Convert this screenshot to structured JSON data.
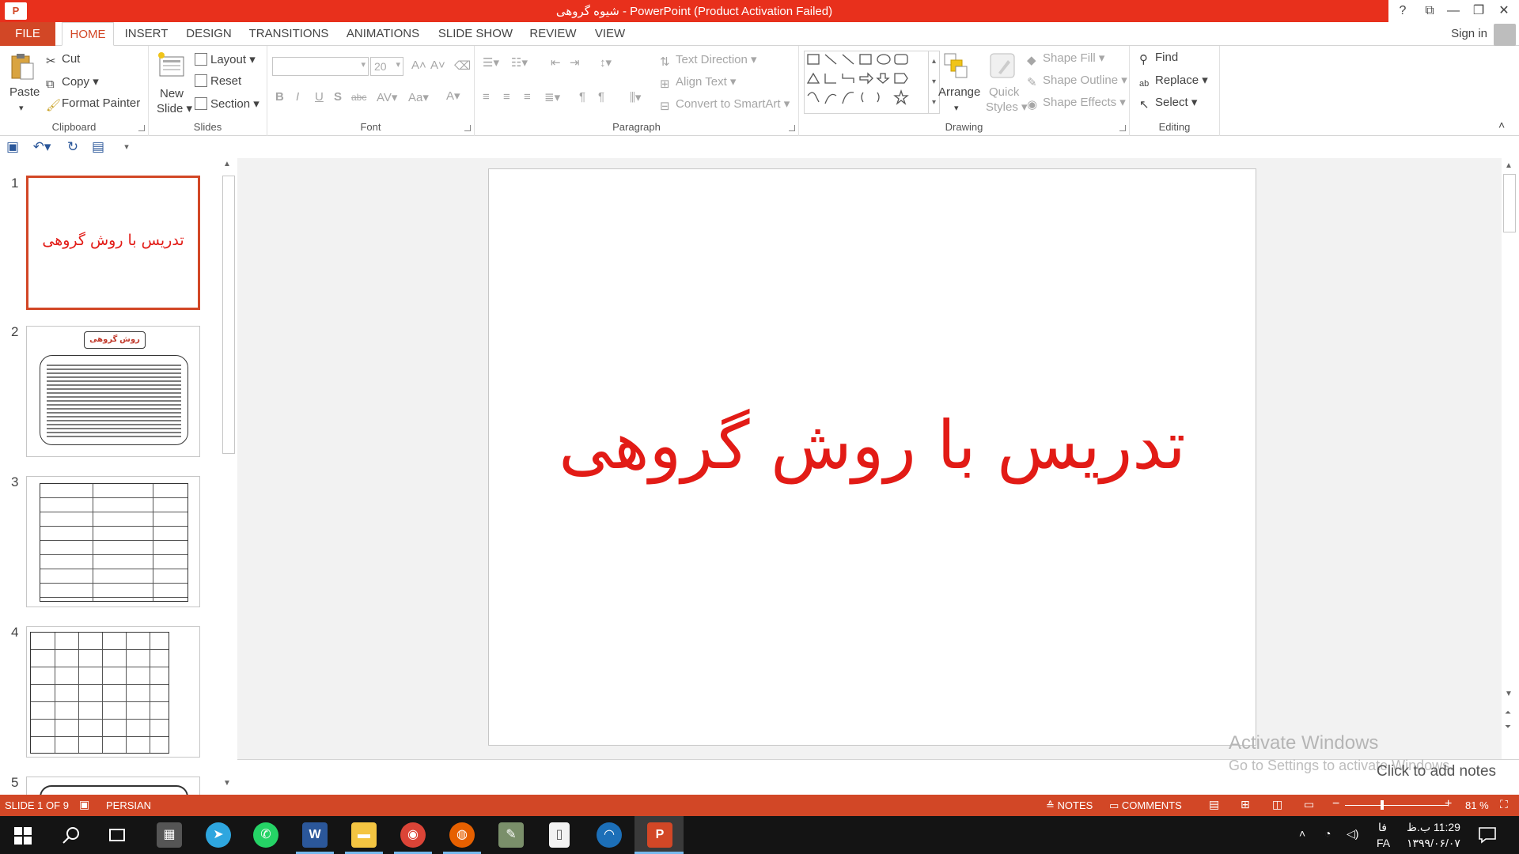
{
  "window": {
    "app_icon_label": "P",
    "title": "شیوه گروهی - PowerPoint (Product Activation Failed)",
    "help": "?",
    "ribbon_display": "⧉",
    "minimize": "—",
    "restore": "❐",
    "close": "✕"
  },
  "tabs": [
    "FILE",
    "HOME",
    "INSERT",
    "DESIGN",
    "TRANSITIONS",
    "ANIMATIONS",
    "SLIDE SHOW",
    "REVIEW",
    "VIEW"
  ],
  "active_tab": "HOME",
  "account": {
    "sign_in": "Sign in"
  },
  "ribbon": {
    "clipboard": {
      "label": "Clipboard",
      "paste": "Paste",
      "cut": "Cut",
      "copy": "Copy",
      "format_painter": "Format Painter"
    },
    "slides": {
      "label": "Slides",
      "new_slide_1": "New",
      "new_slide_2": "Slide",
      "layout": "Layout",
      "reset": "Reset",
      "section": "Section"
    },
    "font": {
      "label": "Font",
      "font_name": "",
      "font_size": "20",
      "bold": "B",
      "italic": "I",
      "underline": "U",
      "shadow": "S",
      "strike": "abc",
      "spacing": "AV",
      "case": "Aa",
      "color": "A"
    },
    "paragraph": {
      "label": "Paragraph",
      "text_direction": "Text Direction",
      "align_text": "Align Text",
      "convert_smartart": "Convert to SmartArt"
    },
    "drawing": {
      "label": "Drawing",
      "arrange": "Arrange",
      "quick_styles_1": "Quick",
      "quick_styles_2": "Styles",
      "shape_fill": "Shape Fill",
      "shape_outline": "Shape Outline",
      "shape_effects": "Shape Effects"
    },
    "editing": {
      "label": "Editing",
      "find": "Find",
      "replace": "Replace",
      "select": "Select"
    }
  },
  "slides": [
    {
      "number": "1",
      "title": "تدریس با روش گروهی"
    },
    {
      "number": "2",
      "title": "روش گروهی"
    },
    {
      "number": "3"
    },
    {
      "number": "4"
    },
    {
      "number": "5"
    }
  ],
  "current_slide": {
    "title": "تدریس با روش گروهی"
  },
  "notes_placeholder": "Click to add notes",
  "watermark": {
    "line1": "Activate Windows",
    "line2": "Go to Settings to activate Windows."
  },
  "status": {
    "slide_of": "SLIDE 1 OF 9",
    "language": "PERSIAN",
    "notes": "NOTES",
    "comments": "COMMENTS",
    "zoom_minus": "−",
    "zoom_plus": "+",
    "zoom": "81 %"
  },
  "taskbar": {
    "word_label": "W",
    "ppt_label": "P",
    "clock_time": "11:29 ب.ظ",
    "clock_date": "۱۳۹۹/۰۶/۰۷",
    "lang_top": "فا",
    "lang_bottom": "FA"
  },
  "colors": {
    "accent": "#d24726",
    "title_red": "#e8301c",
    "slide_text": "#e21b16"
  }
}
